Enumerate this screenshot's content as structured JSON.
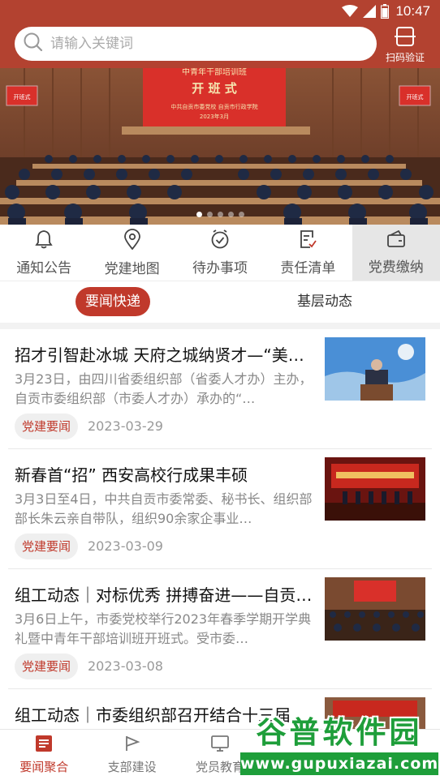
{
  "status_bar": {
    "time": "10:47"
  },
  "search": {
    "placeholder": "请输入关键词"
  },
  "scan": {
    "label": "扫码验证"
  },
  "banner": {
    "screen_title_small": "中青年干部培训班",
    "screen_title_large": "开 班 式",
    "screen_sub": "中共自贡市委党校 自贡市行政学院",
    "screen_date": "2023年3月",
    "side_screen_text": "开班式",
    "slide_count": 5,
    "active_slide": 1
  },
  "quick_nav": [
    {
      "label": "通知公告",
      "icon": "bell-icon"
    },
    {
      "label": "党建地图",
      "icon": "location-pin-icon"
    },
    {
      "label": "待办事项",
      "icon": "clock-check-icon"
    },
    {
      "label": "责任清单",
      "icon": "checklist-icon"
    },
    {
      "label": "党费缴纳",
      "icon": "wallet-icon"
    }
  ],
  "tabs": [
    {
      "label": "要闻快递",
      "active": true
    },
    {
      "label": "基层动态",
      "active": false
    }
  ],
  "news": [
    {
      "title": "招才引智赴冰城 天府之城纳贤才—“美…",
      "summary": "3月23日，由四川省委组织部（省委人才办）主办，自贡市委组织部（市委人才办）承办的“…",
      "tag": "党建要闻",
      "date": "2023-03-29"
    },
    {
      "title": "新春首“招” 西安高校行成果丰硕",
      "summary": "3月3日至4日，中共自贡市委常委、秘书长、组织部部长朱云亲自带队，组织90余家企事业…",
      "tag": "党建要闻",
      "date": "2023-03-09"
    },
    {
      "title": "组工动态｜对标优秀 拼搏奋进——自贡…",
      "summary": "3月6日上午，市委党校举行2023年春季学期开学典礼暨中青年干部培训班开班式。受市委…",
      "tag": "党建要闻",
      "date": "2023-03-08"
    },
    {
      "title": "组工动态｜市委组织部召开结合十三届…",
      "summary": "",
      "tag": "",
      "date": ""
    }
  ],
  "bottom_nav": [
    {
      "label": "要闻聚合",
      "icon": "news-icon",
      "active": true
    },
    {
      "label": "支部建设",
      "icon": "flag-icon",
      "active": false
    },
    {
      "label": "党员教育",
      "icon": "monitor-icon",
      "active": false
    },
    {
      "label": "",
      "icon": "",
      "active": false
    },
    {
      "label": "",
      "icon": "",
      "active": false
    }
  ],
  "watermark": {
    "brand": "谷普软件园",
    "url": "www.gupuxiazai.com"
  },
  "colors": {
    "brand_red": "#b34230",
    "accent_red": "#c0392b",
    "watermark_green": "#1e9e3a"
  }
}
